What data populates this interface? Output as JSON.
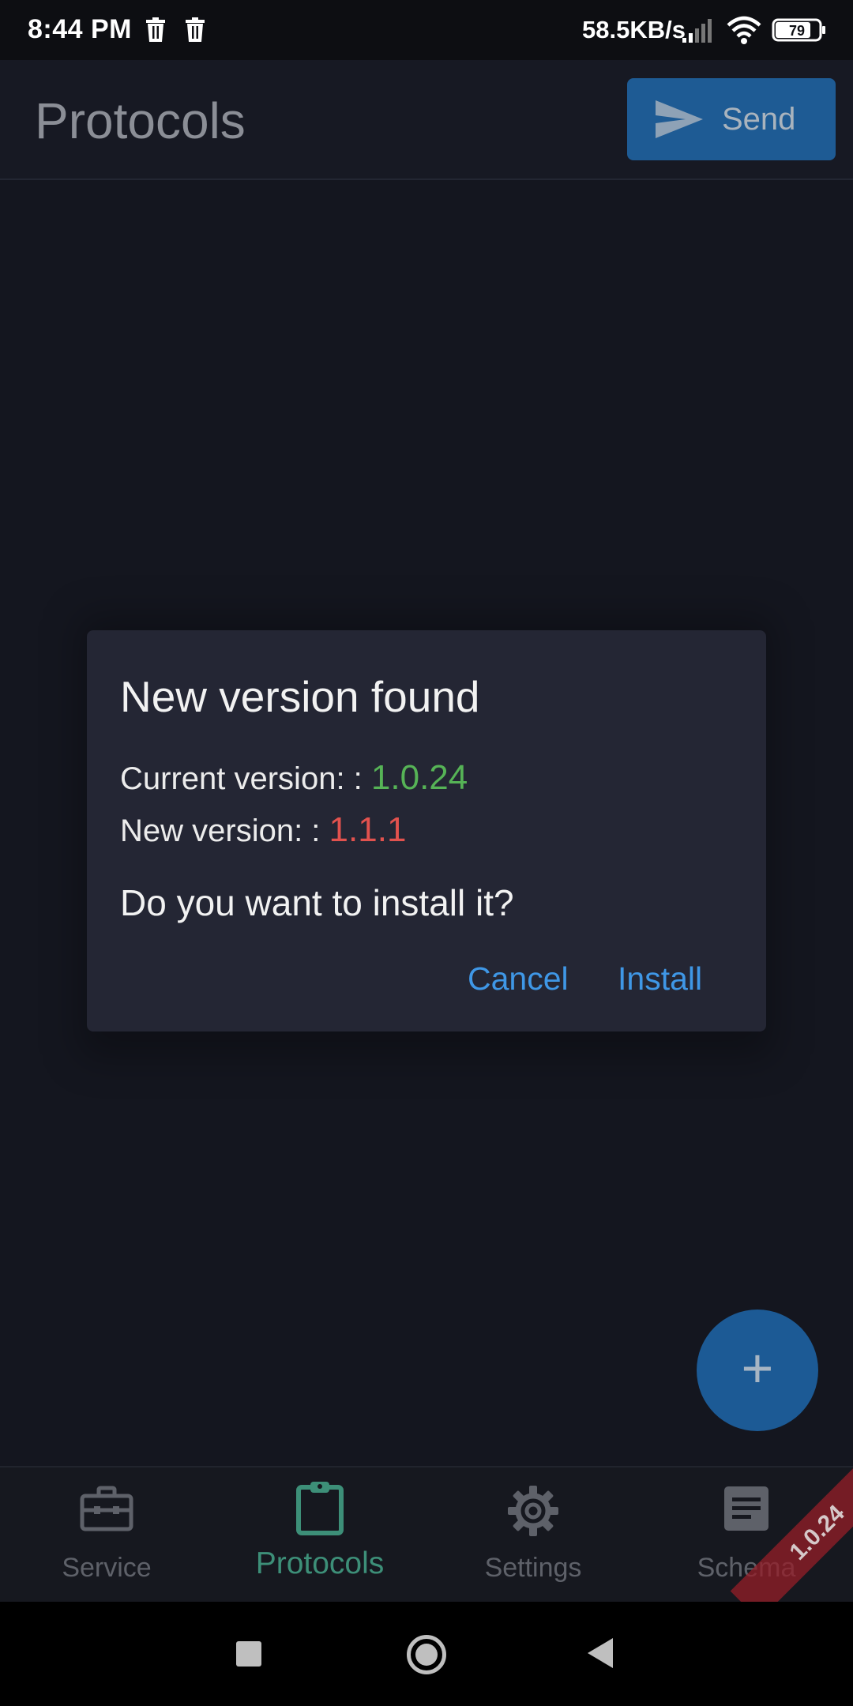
{
  "status_bar": {
    "time": "8:44 PM",
    "speed": "58.5KB/s",
    "battery": "79",
    "icons": [
      "trash-icon",
      "trash-icon",
      "signal-icon",
      "wifi-icon",
      "battery-icon"
    ]
  },
  "app_bar": {
    "title": "Protocols",
    "send_label": "Send",
    "send_icon": "send-icon"
  },
  "dialog": {
    "title": "New version found",
    "current_label": "Current version: :",
    "current_version": "1.0.24",
    "new_label": "New version: :",
    "new_version": "1.1.1",
    "question": "Do you want to install it?",
    "cancel_label": "Cancel",
    "install_label": "Install"
  },
  "fab": {
    "label": "+"
  },
  "bottom_nav": {
    "items": [
      {
        "label": "Service",
        "icon": "toolbox-icon",
        "active": false
      },
      {
        "label": "Protocols",
        "icon": "clipboard-icon",
        "active": true
      },
      {
        "label": "Settings",
        "icon": "gear-icon",
        "active": false
      },
      {
        "label": "Schema",
        "icon": "document-icon",
        "active": false
      }
    ]
  },
  "ribbon": {
    "text": "1.0.24"
  },
  "colors": {
    "accent_blue": "#1e5b94",
    "link_blue": "#3f97e6",
    "active_green": "#3d8f78",
    "version_current": "#56b356",
    "version_new": "#e2524e",
    "dialog_bg": "#242634",
    "page_bg": "#14161f"
  }
}
